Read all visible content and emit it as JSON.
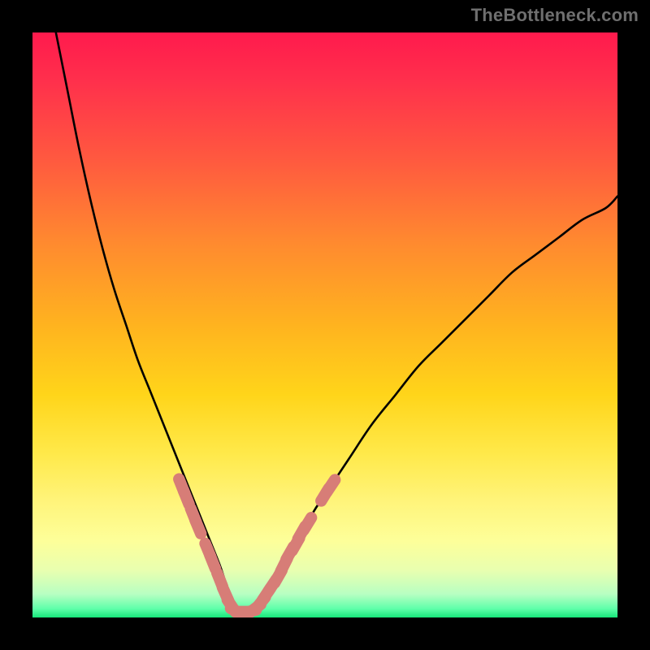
{
  "watermark": {
    "text": "TheBottleneck.com"
  },
  "colors": {
    "background": "#000000",
    "curve": "#000000",
    "marker_fill": "#d77d77",
    "marker_stroke": "#d77d77",
    "gradient_stops": [
      "#ff1a4d",
      "#ff2f4c",
      "#ff5a3f",
      "#ff8a2f",
      "#ffb31f",
      "#ffd51a",
      "#ffe94a",
      "#fff47a",
      "#fdff9a",
      "#e8ffb0",
      "#b8ffc2",
      "#5fffaa",
      "#17e67a"
    ]
  },
  "chart_data": {
    "type": "line",
    "title": "",
    "xlabel": "",
    "ylabel": "",
    "xlim": [
      0,
      100
    ],
    "ylim": [
      0,
      100
    ],
    "grid": false,
    "legend": false,
    "series": [
      {
        "name": "left-branch",
        "x": [
          4,
          6,
          8,
          10,
          12,
          14,
          16,
          18,
          20,
          22,
          24,
          26,
          28,
          30,
          32,
          33,
          34,
          35
        ],
        "y": [
          100,
          90,
          80,
          71,
          63,
          56,
          50,
          44,
          39,
          34,
          29,
          24,
          19,
          14,
          9,
          6,
          3,
          1
        ]
      },
      {
        "name": "right-branch",
        "x": [
          35,
          36,
          37,
          38,
          39,
          40,
          42,
          44,
          46,
          48,
          50,
          54,
          58,
          62,
          66,
          70,
          74,
          78,
          82,
          86,
          90,
          94,
          98,
          100
        ],
        "y": [
          1,
          1,
          1,
          2,
          3,
          5,
          8,
          11,
          14,
          18,
          21,
          27,
          33,
          38,
          43,
          47,
          51,
          55,
          59,
          62,
          65,
          68,
          70,
          72
        ]
      }
    ],
    "markers": {
      "name": "highlight-points",
      "shape": "rounded-capsule",
      "color": "#d77d77",
      "points": [
        {
          "x": 25.5,
          "y": 22.5
        },
        {
          "x": 26.3,
          "y": 20.5
        },
        {
          "x": 27.5,
          "y": 17.5
        },
        {
          "x": 28.3,
          "y": 15.5
        },
        {
          "x": 30.0,
          "y": 11.5
        },
        {
          "x": 30.8,
          "y": 9.5
        },
        {
          "x": 32.0,
          "y": 6.5
        },
        {
          "x": 33.0,
          "y": 4.0
        },
        {
          "x": 34.0,
          "y": 2.0
        },
        {
          "x": 35.0,
          "y": 1.0
        },
        {
          "x": 36.0,
          "y": 1.0
        },
        {
          "x": 37.0,
          "y": 1.0
        },
        {
          "x": 38.0,
          "y": 1.5
        },
        {
          "x": 39.0,
          "y": 2.5
        },
        {
          "x": 40.0,
          "y": 4.0
        },
        {
          "x": 41.0,
          "y": 5.5
        },
        {
          "x": 42.0,
          "y": 7.0
        },
        {
          "x": 43.0,
          "y": 9.0
        },
        {
          "x": 44.0,
          "y": 11.0
        },
        {
          "x": 45.0,
          "y": 12.5
        },
        {
          "x": 46.0,
          "y": 14.5
        },
        {
          "x": 47.0,
          "y": 16.0
        },
        {
          "x": 50.0,
          "y": 21.0
        },
        {
          "x": 51.0,
          "y": 22.5
        }
      ]
    }
  }
}
